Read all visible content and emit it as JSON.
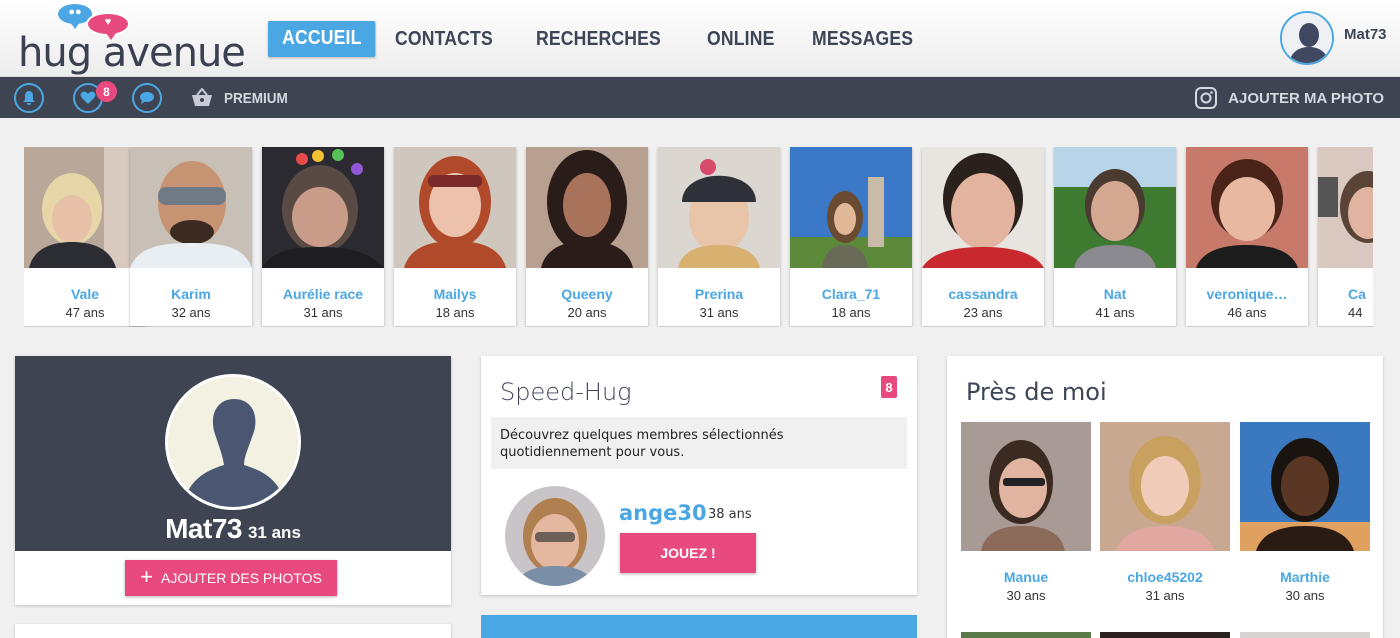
{
  "brand": {
    "name": "hug avenue"
  },
  "nav": {
    "items": [
      {
        "label": "ACCUEIL",
        "active": true
      },
      {
        "label": "CONTACTS"
      },
      {
        "label": "RECHERCHES"
      },
      {
        "label": "ONLINE"
      },
      {
        "label": "MESSAGES"
      }
    ]
  },
  "user": {
    "name": "Mat73"
  },
  "subbar": {
    "icons": [
      "bell-icon",
      "heart-icon",
      "chat-icon"
    ],
    "heart_badge": "8",
    "premium_label": "PREMIUM",
    "add_photo_label": "AJOUTER MA PHOTO"
  },
  "profiles": [
    {
      "name": "Vale",
      "age": "47 ans"
    },
    {
      "name": "Karim",
      "age": "32 ans"
    },
    {
      "name": "Aurélie race",
      "age": "31 ans"
    },
    {
      "name": "Mailys",
      "age": "18 ans"
    },
    {
      "name": "Queeny",
      "age": "20 ans"
    },
    {
      "name": "Prerina",
      "age": "31 ans"
    },
    {
      "name": "Clara_71",
      "age": "18 ans"
    },
    {
      "name": "cassandra",
      "age": "23 ans"
    },
    {
      "name": "Nat",
      "age": "41 ans"
    },
    {
      "name": "veronique…",
      "age": "46 ans"
    },
    {
      "name": "Ca",
      "age": "44"
    }
  ],
  "me": {
    "name": "Mat73",
    "age": "31 ans",
    "add_photos_label": "AJOUTER DES PHOTOS"
  },
  "speed_hug": {
    "title": "Speed-Hug",
    "count": "8",
    "description": "Découvrez quelques membres sélectionnés quotidiennement pour vous.",
    "member_name": "ange30",
    "member_age": "38 ans",
    "play_label": "JOUEZ !"
  },
  "near_me": {
    "title": "Près de moi",
    "items": [
      {
        "name": "Manue",
        "age": "30 ans"
      },
      {
        "name": "chloe45202",
        "age": "31 ans"
      },
      {
        "name": "Marthie",
        "age": "30 ans"
      }
    ]
  },
  "colors": {
    "accent": "#4ba7e3",
    "pink": "#e84a7f",
    "dark": "#3e4452"
  }
}
